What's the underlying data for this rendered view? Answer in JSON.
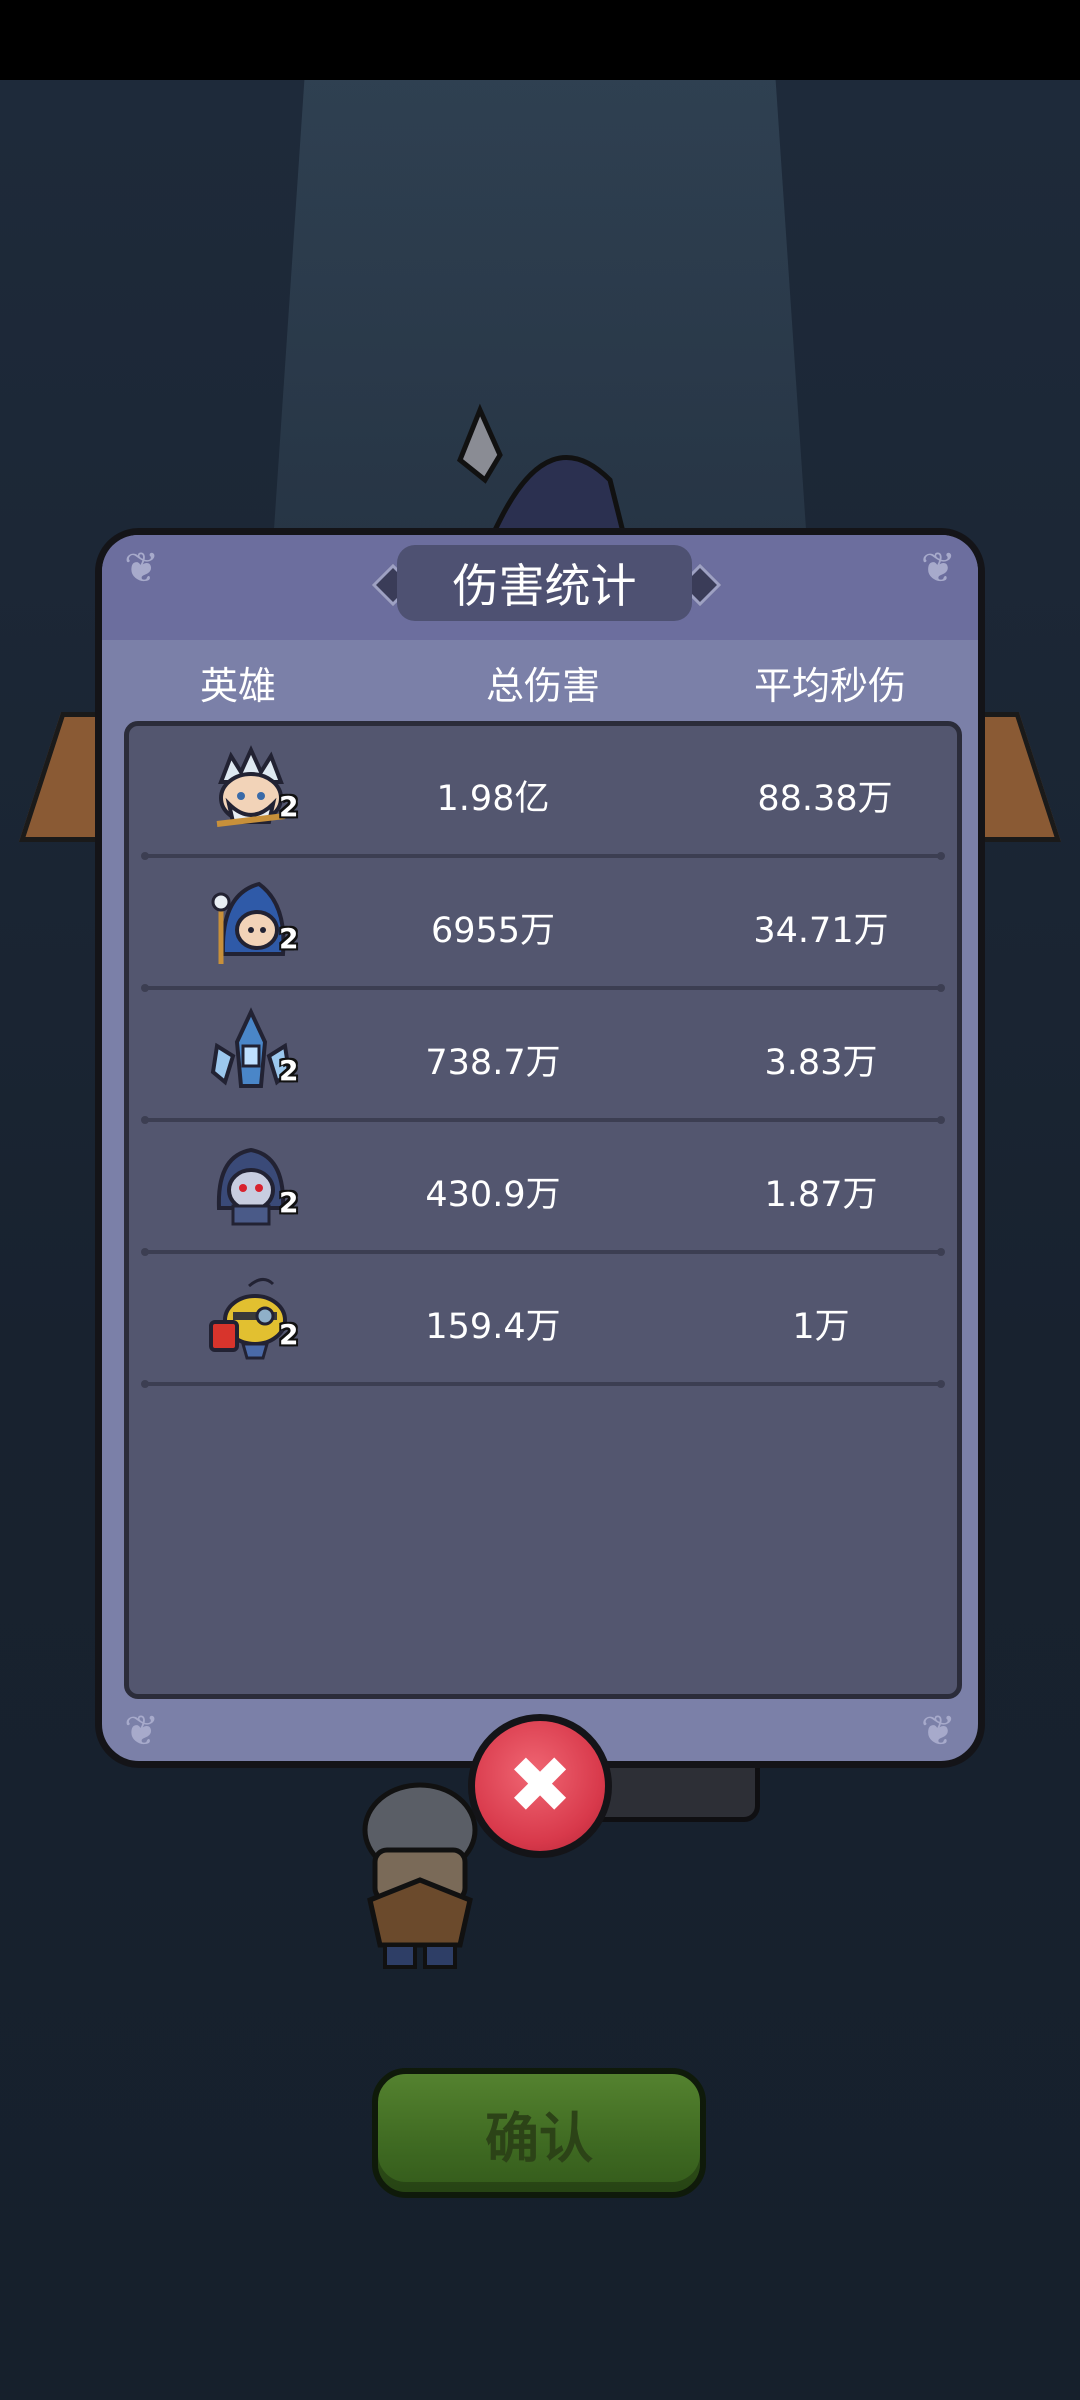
{
  "dialog": {
    "title": "伤害统计",
    "columns": {
      "hero": "英雄",
      "total_damage": "总伤害",
      "dps": "平均秒伤"
    },
    "rows": [
      {
        "hero_icon": "ice-king-hero-icon",
        "star": "2",
        "total_damage": "1.98亿",
        "dps": "88.38万"
      },
      {
        "hero_icon": "hooded-mage-hero-icon",
        "star": "2",
        "total_damage": "6955万",
        "dps": "34.71万"
      },
      {
        "hero_icon": "frost-knight-hero-icon",
        "star": "2",
        "total_damage": "738.7万",
        "dps": "3.83万"
      },
      {
        "hero_icon": "shadow-assassin-hero-icon",
        "star": "2",
        "total_damage": "430.9万",
        "dps": "1.87万"
      },
      {
        "hero_icon": "mecha-bee-hero-icon",
        "star": "2",
        "total_damage": "159.4万",
        "dps": "1万"
      }
    ],
    "close_icon": "close-x-icon"
  },
  "confirm_button": {
    "label": "确认"
  },
  "colors": {
    "dialog_bg": "#7b80a8",
    "panel_bg": "#53566f",
    "close_button": "#d8394b",
    "confirm_button": "#3f6a22"
  }
}
